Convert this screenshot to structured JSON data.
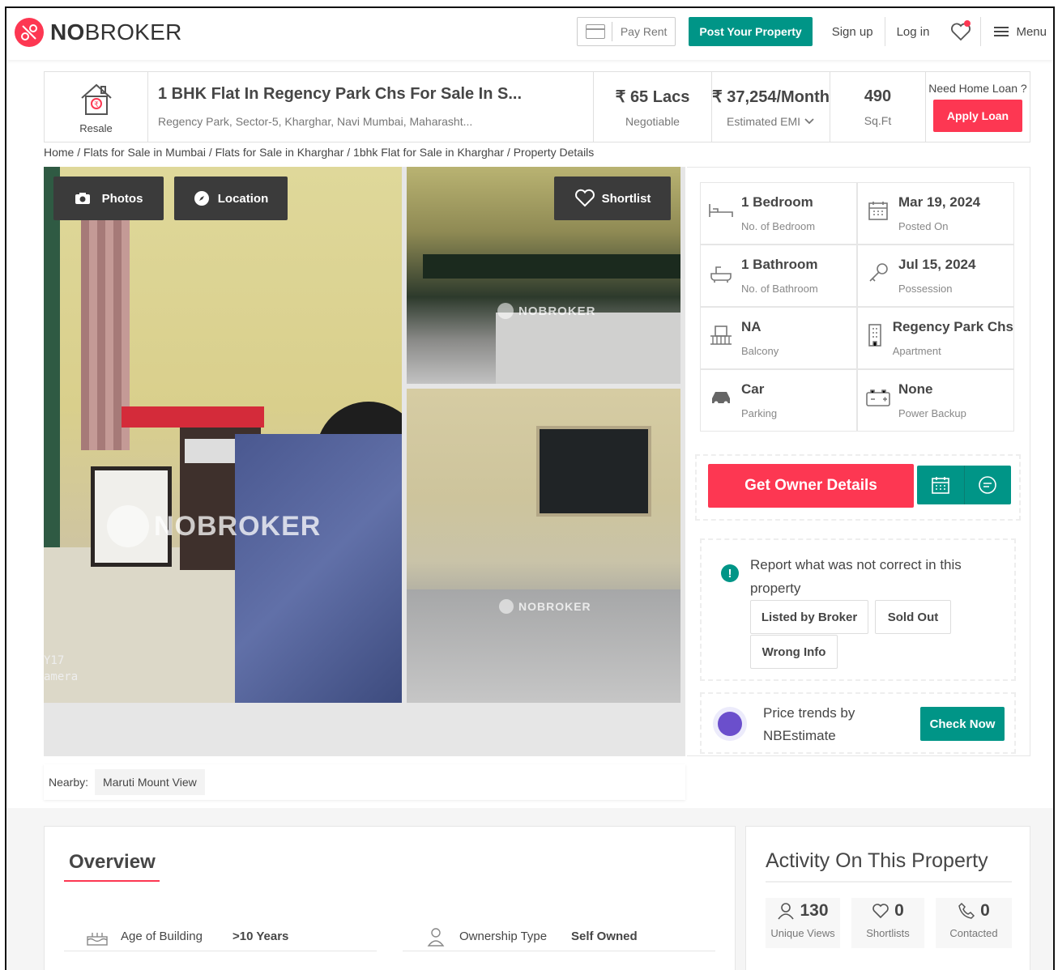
{
  "brand": {
    "name_bold": "NO",
    "name_rest": "BROKER",
    "accent": "#fd3752",
    "green": "#009587"
  },
  "nav": {
    "pay_rent": "Pay Rent",
    "post_property": "Post Your Property",
    "sign_up": "Sign up",
    "log_in": "Log in",
    "menu": "Menu"
  },
  "header": {
    "type_label": "Resale",
    "title": "1 BHK Flat In Regency Park Chs For Sale In S...",
    "address": "Regency Park, Sector-5, Kharghar, Navi Mumbai, Maharasht...",
    "price": "₹ 65 Lacs",
    "price_note": "Negotiable",
    "emi": "₹ 37,254/Month",
    "emi_label": "Estimated EMI",
    "area": "490",
    "area_unit": "Sq.Ft",
    "loan_question": "Need Home Loan ?",
    "apply_loan": "Apply Loan"
  },
  "breadcrumb": "Home / Flats for Sale in Mumbai / Flats for Sale in Kharghar / 1bhk Flat for Sale in Kharghar / Property Details",
  "gallery": {
    "photos": "Photos",
    "location": "Location",
    "shortlist": "Shortlist",
    "watermark": "NOBROKER",
    "camera_text_1": "Y17",
    "camera_text_2": "amera"
  },
  "specs": [
    {
      "value": "1 Bedroom",
      "label": "No. of Bedroom",
      "icon": "bed-icon"
    },
    {
      "value": "Mar 19, 2024",
      "label": "Posted On",
      "icon": "calendar-icon"
    },
    {
      "value": "1 Bathroom",
      "label": "No. of Bathroom",
      "icon": "bathtub-icon"
    },
    {
      "value": "Jul 15, 2024",
      "label": "Possession",
      "icon": "key-icon"
    },
    {
      "value": "NA",
      "label": "Balcony",
      "icon": "balcony-icon"
    },
    {
      "value": "Regency Park Chs",
      "label": "Apartment",
      "icon": "building-icon"
    },
    {
      "value": "Car",
      "label": "Parking",
      "icon": "car-icon"
    },
    {
      "value": "None",
      "label": "Power Backup",
      "icon": "battery-icon"
    }
  ],
  "owner": {
    "get_details": "Get Owner Details"
  },
  "report": {
    "text": "Report what was not correct in this property",
    "tags": [
      "Listed by Broker",
      "Sold Out",
      "Wrong Info"
    ]
  },
  "trends": {
    "line1": "Price trends by",
    "line2": "NBEstimate",
    "button": "Check Now"
  },
  "nearby": {
    "label": "Nearby:",
    "place": "Maruti Mount View"
  },
  "overview": {
    "title": "Overview",
    "rows": [
      {
        "label": "Age of Building",
        "value": ">10 Years"
      },
      {
        "label": "Ownership Type",
        "value": "Self Owned"
      }
    ]
  },
  "activity": {
    "title": "Activity On This Property",
    "stats": [
      {
        "value": "130",
        "label": "Unique Views"
      },
      {
        "value": "0",
        "label": "Shortlists"
      },
      {
        "value": "0",
        "label": "Contacted"
      }
    ]
  }
}
